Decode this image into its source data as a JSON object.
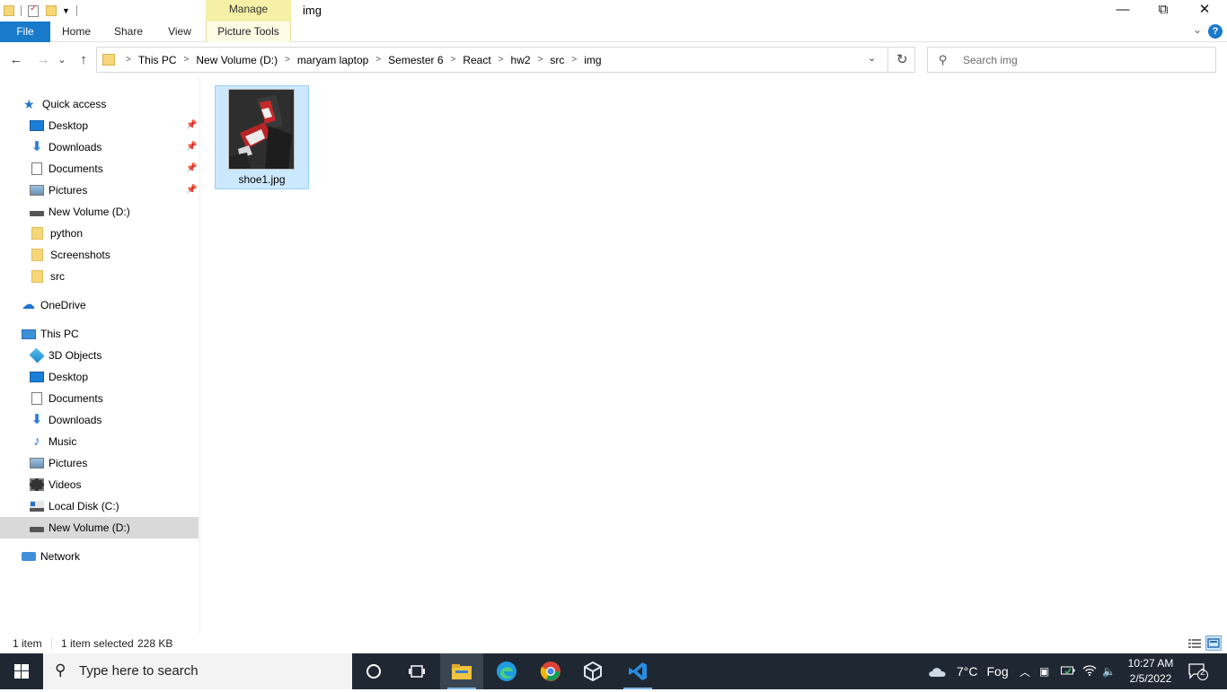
{
  "window": {
    "title": "img",
    "contextual_tab_group": "Manage",
    "controls": {
      "minimize": "—",
      "maximize": "⧉",
      "close": "✕"
    }
  },
  "ribbon": {
    "tabs": [
      "File",
      "Home",
      "Share",
      "View",
      "Picture Tools"
    ],
    "file_tab_color": "#1979ca",
    "help": "?"
  },
  "nav": {
    "back": "←",
    "forward": "→",
    "recent": "⌄",
    "up": "↑"
  },
  "address": {
    "crumbs": [
      "This PC",
      "New Volume (D:)",
      "maryam laptop",
      "Semester 6",
      "React",
      "hw2",
      "src",
      "img"
    ],
    "refresh": "↻"
  },
  "search": {
    "placeholder": "Search img"
  },
  "sidebar": {
    "quick_access": {
      "label": "Quick access",
      "items": [
        "Desktop",
        "Downloads",
        "Documents",
        "Pictures",
        "New Volume (D:)",
        "python",
        "Screenshots",
        "src"
      ]
    },
    "onedrive": "OneDrive",
    "this_pc": {
      "label": "This PC",
      "items": [
        "3D Objects",
        "Desktop",
        "Documents",
        "Downloads",
        "Music",
        "Pictures",
        "Videos",
        "Local Disk (C:)",
        "New Volume (D:)"
      ]
    },
    "network": "Network"
  },
  "files": [
    {
      "name": "shoe1.jpg",
      "selected": true
    }
  ],
  "status": {
    "item_count": "1 item",
    "selected": "1 item selected",
    "size": "228 KB"
  },
  "taskbar": {
    "search_placeholder": "Type here to search",
    "weather": "7°C",
    "weather_desc": "Fog",
    "time": "10:27 AM",
    "date": "2/5/2022",
    "notifications": "2"
  }
}
